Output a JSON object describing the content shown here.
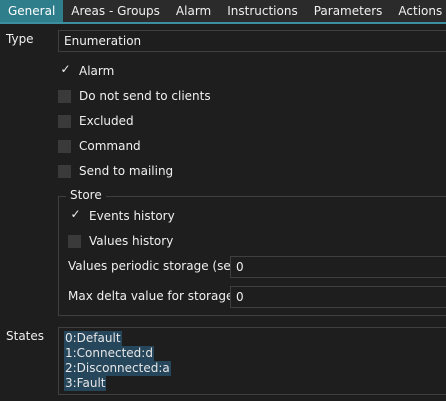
{
  "tabs": [
    {
      "label": "General",
      "active": true
    },
    {
      "label": "Areas - Groups",
      "active": false
    },
    {
      "label": "Alarm",
      "active": false
    },
    {
      "label": "Instructions",
      "active": false
    },
    {
      "label": "Parameters",
      "active": false
    },
    {
      "label": "Actions",
      "active": false
    }
  ],
  "type": {
    "label": "Type",
    "value": "Enumeration"
  },
  "checks": [
    {
      "label": "Alarm",
      "checked": true
    },
    {
      "label": "Do not send to clients",
      "checked": false
    },
    {
      "label": "Excluded",
      "checked": false
    },
    {
      "label": "Command",
      "checked": false
    },
    {
      "label": "Send to mailing",
      "checked": false
    }
  ],
  "store": {
    "title": "Store",
    "events_history": {
      "label": "Events history",
      "checked": true
    },
    "values_history": {
      "label": "Values history",
      "checked": false
    },
    "periodic_label": "Values periodic storage (sec):",
    "periodic_value": "0",
    "delta_label": "Max delta value for storage:",
    "delta_value": "0"
  },
  "states": {
    "label": "States",
    "lines": [
      "0:Default",
      "1:Connected:d",
      "2:Disconnected:a",
      "3:Fault"
    ]
  },
  "colors": {
    "background": "#1e1e1e",
    "tab_active": "#2f7e8c",
    "selection": "#26465c"
  }
}
